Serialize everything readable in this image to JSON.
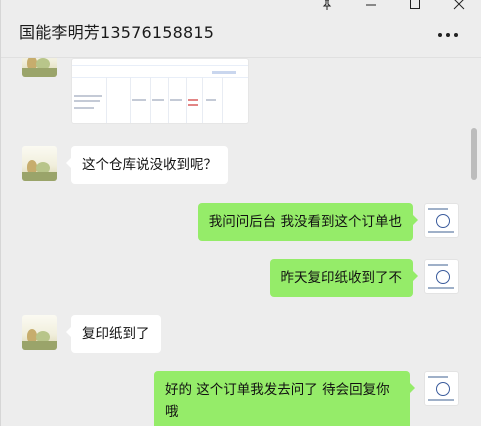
{
  "header": {
    "title": "国能李明芳13576158815"
  },
  "window_controls": [
    "pin-icon",
    "minimize-icon",
    "maximize-icon",
    "close-icon"
  ],
  "messages": [
    {
      "side": "left",
      "type": "image"
    },
    {
      "side": "left",
      "type": "text",
      "text": "这个仓库说没收到呢？"
    },
    {
      "side": "right",
      "type": "text",
      "text": "我问问后台 我没看到这个订单也"
    },
    {
      "side": "right",
      "type": "text",
      "text": "昨天复印纸收到了不"
    },
    {
      "side": "left",
      "type": "text",
      "text": "复印纸到了"
    },
    {
      "side": "right",
      "type": "text",
      "text": "好的 这个订单我发去问了 待会回复你哦"
    }
  ],
  "colors": {
    "background": "#ededed",
    "bubble_self": "#95ec69",
    "bubble_other": "#ffffff"
  }
}
